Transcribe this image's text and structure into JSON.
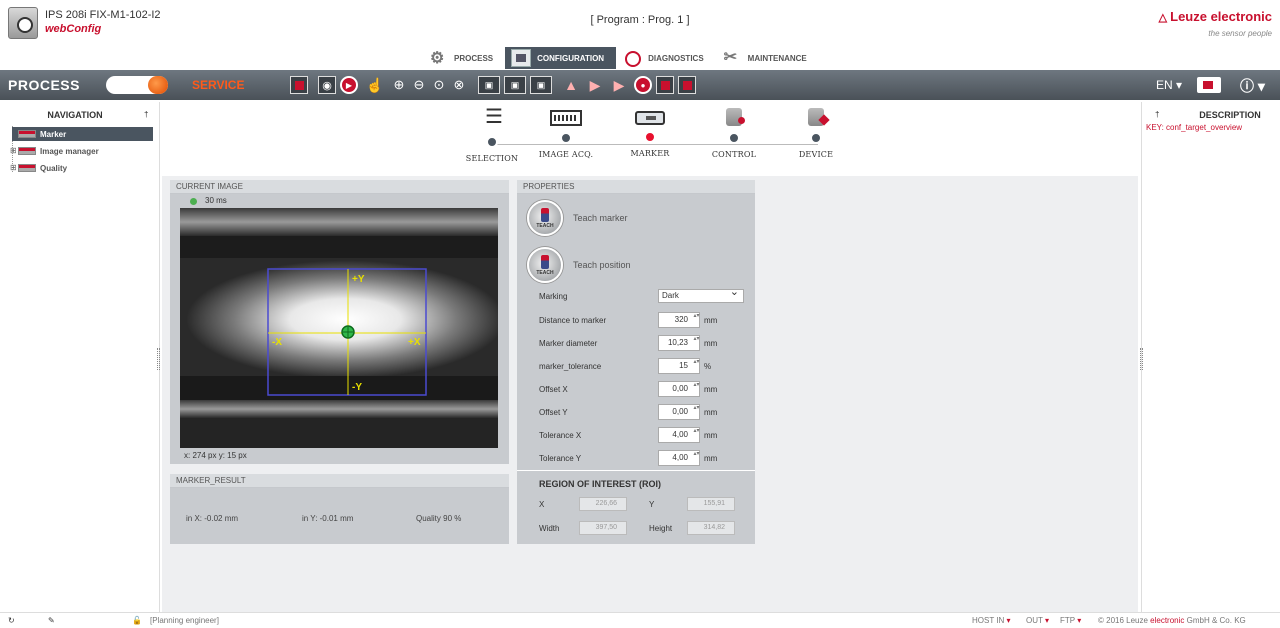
{
  "header": {
    "device_name": "IPS 208i FIX-M1-102-I2",
    "app_name": "webConfig",
    "program_label": "[ Program : Prog. 1 ]",
    "brand_name": "Leuze electronic",
    "brand_slogan": "the sensor people"
  },
  "main_tabs": [
    {
      "label": "PROCESS",
      "icon": "process-icon",
      "active": false
    },
    {
      "label": "CONFIGURATION",
      "icon": "configuration-icon",
      "active": true
    },
    {
      "label": "DIAGNOSTICS",
      "icon": "diagnostics-icon",
      "active": false
    },
    {
      "label": "MAINTENANCE",
      "icon": "maintenance-icon",
      "active": false
    }
  ],
  "toolbar": {
    "mode_process": "PROCESS",
    "mode_service": "SERVICE",
    "language": "EN",
    "language_caret": "▾",
    "info_caret": "ⓘ ▾"
  },
  "navigation": {
    "title": "NAVIGATION",
    "pin": "†",
    "items": [
      {
        "label": "Marker",
        "selected": true
      },
      {
        "label": "Image manager",
        "selected": false
      },
      {
        "label": "Quality",
        "selected": false
      }
    ]
  },
  "workflow": {
    "steps": [
      {
        "label": "SELECTION",
        "icon": "selection-list-icon",
        "active": false
      },
      {
        "label": "IMAGE ACQ.",
        "icon": "image-acquisition-icon",
        "active": false
      },
      {
        "label": "MARKER",
        "icon": "marker-icon",
        "active": true
      },
      {
        "label": "CONTROL",
        "icon": "control-icon",
        "active": false
      },
      {
        "label": "DEVICE",
        "icon": "device-icon",
        "active": false
      }
    ]
  },
  "current_image": {
    "title": "CURRENT IMAGE",
    "exposure_time": "30 ms",
    "pixel_coords": "x: 274 px y: 15 px",
    "overlay": {
      "plus_y": "+Y",
      "minus_y": "-Y",
      "plus_x": "+X",
      "minus_x": "-X"
    }
  },
  "marker_result": {
    "title": "MARKER_RESULT",
    "x_text": "in X:  -0.02  mm",
    "y_text": "in Y:  -0.01  mm",
    "quality_text": "Quality  90  %"
  },
  "properties": {
    "title": "PROPERTIES",
    "teach_marker": "Teach marker",
    "teach_position": "Teach position",
    "teach_badge": "TEACH",
    "marking": {
      "label": "Marking",
      "value": "Dark"
    },
    "fields": [
      {
        "label": "Distance to marker",
        "value": "320",
        "unit": "mm"
      },
      {
        "label": "Marker diameter",
        "value": "10,23",
        "unit": "mm"
      },
      {
        "label": "marker_tolerance",
        "value": "15",
        "unit": "%"
      },
      {
        "label": "Offset X",
        "value": "0,00",
        "unit": "mm"
      },
      {
        "label": "Offset Y",
        "value": "0,00",
        "unit": "mm"
      },
      {
        "label": "Tolerance X",
        "value": "4,00",
        "unit": "mm"
      },
      {
        "label": "Tolerance Y",
        "value": "4,00",
        "unit": "mm"
      }
    ],
    "spin_glyph": "▴▾"
  },
  "roi": {
    "title": "REGION OF INTEREST (ROI)",
    "x_label": "X",
    "x_value": "226,66",
    "y_label": "Y",
    "y_value": "155,91",
    "width_label": "Width",
    "width_value": "397,50",
    "height_label": "Height",
    "height_value": "314,82"
  },
  "description": {
    "title": "DESCRIPTION",
    "pin": "†",
    "key": "KEY: conf_target_overview"
  },
  "statusbar": {
    "user_role": "[Planning engineer]",
    "host": "HOST IN",
    "out": "OUT",
    "ftp": "FTP",
    "copyright_prefix": "© 2016 Leuze ",
    "copyright_brand": "electronic",
    "copyright_suffix": " GmbH & Co. KG"
  },
  "colors": {
    "brand_red": "#c8102e",
    "toolbar_gray": "#4a5158",
    "active_tab": "#4a5560",
    "service_orange": "#ff5a1a",
    "status_green": "#4caf50"
  }
}
